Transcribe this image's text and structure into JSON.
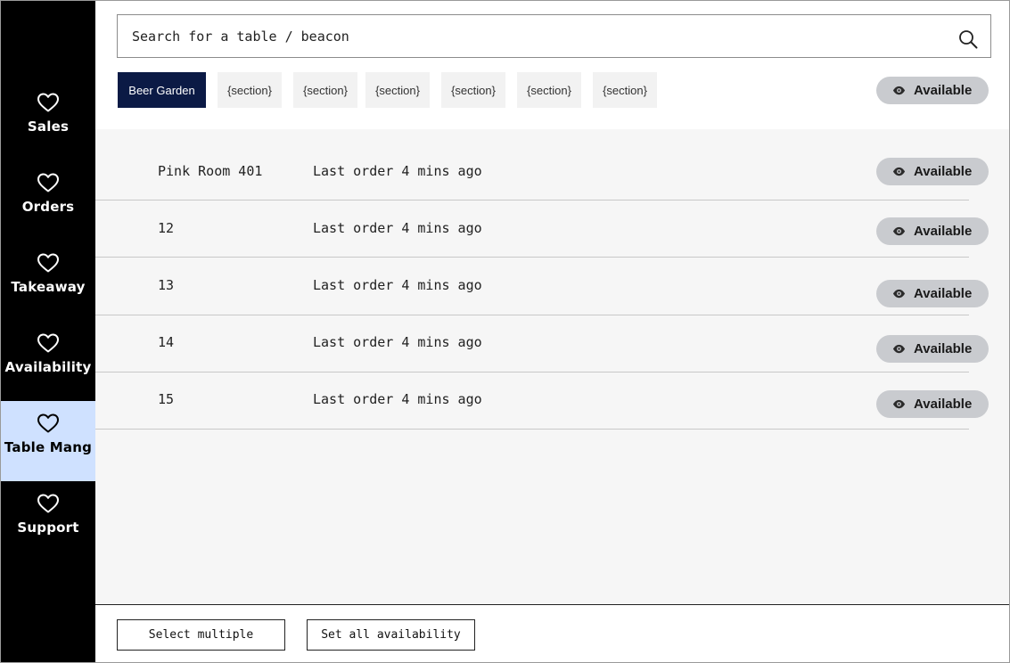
{
  "sidebar": {
    "items": [
      {
        "label": "Sales",
        "icon": "heart-icon"
      },
      {
        "label": "Orders",
        "icon": "heart-icon"
      },
      {
        "label": "Takeaway",
        "icon": "heart-icon"
      },
      {
        "label": "Availability",
        "icon": "heart-icon"
      },
      {
        "label": "Table Mang",
        "icon": "heart-icon",
        "active": true
      },
      {
        "label": "Support",
        "icon": "heart-icon"
      }
    ]
  },
  "search": {
    "placeholder": "Search for a table / beacon",
    "value": "",
    "icon": "search-icon"
  },
  "sections": {
    "tabs": [
      {
        "label": "Beer Garden",
        "active": true
      },
      {
        "label": "{section}"
      },
      {
        "label": "{section}"
      },
      {
        "label": "{section}"
      },
      {
        "label": "{section}"
      },
      {
        "label": "{section}"
      },
      {
        "label": "{section}"
      }
    ],
    "status_label": "Available"
  },
  "tables": [
    {
      "name": "Pink Room 401",
      "last_order": "Last order 4 mins ago",
      "status": "Available"
    },
    {
      "name": "12",
      "last_order": "Last order 4 mins ago",
      "status": "Available"
    },
    {
      "name": "13",
      "last_order": "Last order 4 mins ago",
      "status": "Available"
    },
    {
      "name": "14",
      "last_order": "Last order 4 mins ago",
      "status": "Available"
    },
    {
      "name": "15",
      "last_order": "Last order 4 mins ago",
      "status": "Available"
    }
  ],
  "footer": {
    "select_multiple_label": "Select multiple",
    "set_all_label": "Set all availability"
  },
  "colors": {
    "sidebar_bg": "#000000",
    "active_nav_bg": "#cfe1ff",
    "active_tab_bg": "#0b1a45",
    "pill_bg": "#c9cbcf",
    "list_bg": "#f6f6f6"
  }
}
